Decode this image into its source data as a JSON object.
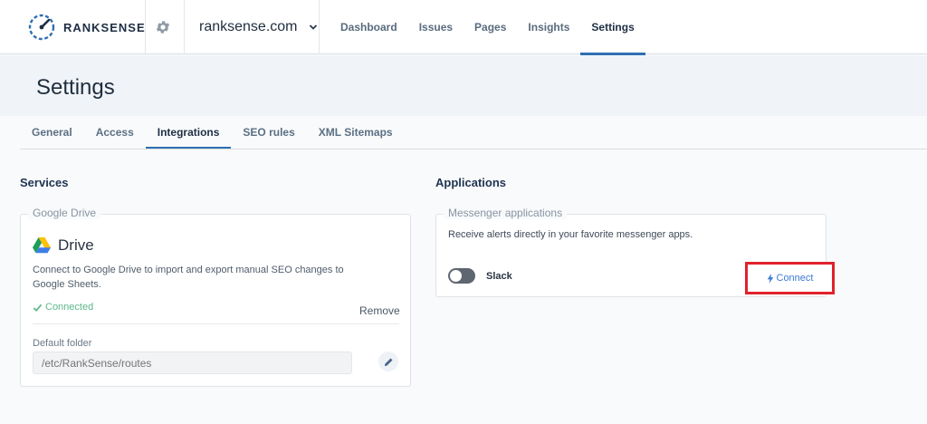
{
  "brand": {
    "name": "RANKSENSE"
  },
  "site_selector": {
    "value": "ranksense.com"
  },
  "nav": {
    "items": [
      {
        "label": "Dashboard",
        "active": false
      },
      {
        "label": "Issues",
        "active": false
      },
      {
        "label": "Pages",
        "active": false
      },
      {
        "label": "Insights",
        "active": false
      },
      {
        "label": "Settings",
        "active": true
      }
    ]
  },
  "page": {
    "title": "Settings"
  },
  "tabs": [
    {
      "label": "General",
      "active": false
    },
    {
      "label": "Access",
      "active": false
    },
    {
      "label": "Integrations",
      "active": true
    },
    {
      "label": "SEO rules",
      "active": false
    },
    {
      "label": "XML Sitemaps",
      "active": false
    }
  ],
  "services": {
    "title": "Services",
    "google_drive": {
      "legend": "Google Drive",
      "name": "Drive",
      "description": "Connect to Google Drive to import and export manual SEO changes to Google Sheets.",
      "status": "Connected",
      "remove_label": "Remove",
      "folder_label": "Default folder",
      "folder_placeholder": "/etc/RankSense/routes"
    }
  },
  "applications": {
    "title": "Applications",
    "messenger": {
      "legend": "Messenger applications",
      "description": "Receive alerts directly in your favorite messenger apps.",
      "slack_label": "Slack",
      "slack_enabled": false,
      "connect_label": "Connect"
    }
  },
  "icons": {
    "logo": "ranksense-logo-icon",
    "gear": "gear-icon",
    "chevron": "chevron-down-icon",
    "drive": "google-drive-icon",
    "check": "check-icon",
    "edit": "pencil-icon",
    "bolt": "lightning-bolt-icon"
  },
  "colors": {
    "accent": "#2f6fb3",
    "connected": "#5cb88a",
    "link": "#3a7bd5",
    "highlight_border": "#e0222b"
  }
}
